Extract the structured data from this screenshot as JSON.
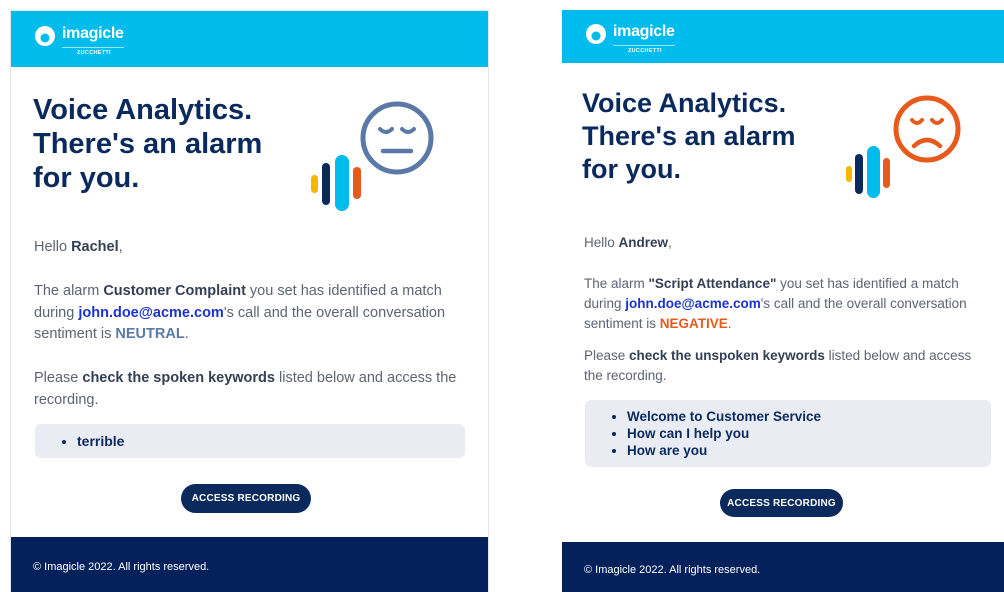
{
  "brand": {
    "name": "imagicle",
    "sub": "ZUCCHETTI"
  },
  "colors": {
    "header": "#00bcec",
    "navy": "#0a2a5e",
    "footer": "#05215b",
    "neutral": "#5b79a6",
    "negative": "#e85a1c",
    "link": "#1a33cc"
  },
  "emails": [
    {
      "headline": "Voice Analytics.\nThere's an alarm\nfor you.",
      "face_icon": "neutral-face-icon",
      "greeting_prefix": "Hello ",
      "user_name": "Rachel",
      "greeting_suffix": ",",
      "alarm_prefix": "The alarm ",
      "alarm_name": "Customer Complaint",
      "alarm_mid": " you set has identified a match during ",
      "caller_email": "john.doe@acme.com",
      "alarm_mid2": "'s call and the overall conversation sentiment is ",
      "sentiment": "NEUTRAL",
      "alarm_end": ".",
      "check_prefix": "Please ",
      "check_bold": "check the spoken keywords",
      "check_suffix": " listed below and access the recording.",
      "keywords": [
        "terrible"
      ],
      "cta_label": "ACCESS RECORDING",
      "footer": "© Imagicle 2022. All rights reserved."
    },
    {
      "headline": "Voice Analytics.\nThere's an alarm\nfor you.",
      "face_icon": "sad-face-icon",
      "greeting_prefix": "Hello ",
      "user_name": "Andrew",
      "greeting_suffix": ",",
      "alarm_prefix": "The alarm ",
      "alarm_name": "\"Script Attendance\"",
      "alarm_mid": " you set has identified a match during ",
      "caller_email": "john.doe@acme.com",
      "alarm_mid2": "'s call and the overall conversation sentiment is ",
      "sentiment": "NEGATIVE",
      "alarm_end": ".",
      "check_prefix": "Please ",
      "check_bold": "check the unspoken keywords",
      "check_suffix": " listed below and access the recording.",
      "keywords": [
        "Welcome to Customer Service",
        "How can I help you",
        "How are you"
      ],
      "cta_label": "ACCESS RECORDING",
      "footer": "© Imagicle 2022. All rights reserved."
    }
  ]
}
